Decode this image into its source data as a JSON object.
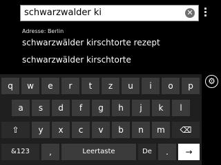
{
  "search": {
    "query": "schwarzwalder ki",
    "clear_icon": "✕"
  },
  "address_label": "Adresse: Berlin",
  "suggestions": [
    "schwarzwälder kirschtorte rezept",
    "schwarzwälder kirschtorte"
  ],
  "keyboard": {
    "row1": [
      "q",
      "w",
      "e",
      "r",
      "t",
      "z",
      "u",
      "i",
      "o",
      "p"
    ],
    "row2": [
      "a",
      "s",
      "d",
      "f",
      "g",
      "h",
      "j",
      "k",
      "l"
    ],
    "row3_letters": [
      "y",
      "x",
      "c",
      "v",
      "b",
      "n",
      "m"
    ],
    "shift_icon": "⇧",
    "backspace_icon": "⌫",
    "numbers": "&123",
    "comma": ",",
    "space": "Leertaste",
    "language": "De",
    "period": ".",
    "enter_icon": "→"
  },
  "settings_icon": "⚙"
}
